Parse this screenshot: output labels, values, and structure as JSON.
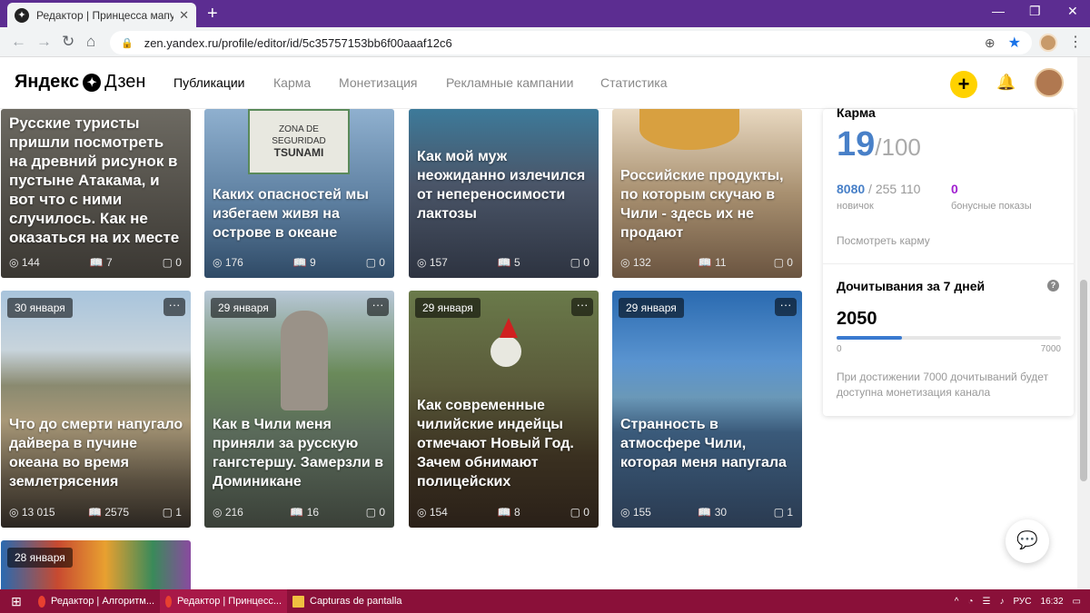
{
  "browser": {
    "tab_title": "Редактор | Принцесса мапуче |",
    "url": "zen.yandex.ru/profile/editor/id/5c35757153bb6f00aaaf12c6"
  },
  "header": {
    "logo_left": "Яндекс",
    "logo_right": "Дзен",
    "nav": [
      "Публикации",
      "Карма",
      "Монетизация",
      "Рекламные кампании",
      "Статистика"
    ]
  },
  "cards": [
    {
      "title": "Русские туристы пришли посмотреть на древний рисунок в пустыне Атакама, и вот что с ними случилось. Как не оказаться на их месте",
      "views": "144",
      "reads": "7",
      "comments": "0"
    },
    {
      "title": "Каких опасностей мы избегаем живя на острове в океане",
      "views": "176",
      "reads": "9",
      "comments": "0"
    },
    {
      "title": "Как мой муж неожиданно излечился от непереносимости лактозы",
      "views": "157",
      "reads": "5",
      "comments": "0"
    },
    {
      "title": "Российские продукты, по которым скучаю в Чили - здесь их не продают",
      "views": "132",
      "reads": "11",
      "comments": "0"
    },
    {
      "date": "30 января",
      "title": "Что до смерти напугало дайвера в пучине океана во время землетрясения",
      "views": "13 015",
      "reads": "2575",
      "comments": "1"
    },
    {
      "date": "29 января",
      "title": "Как в Чили меня приняли за русскую гангстершу. Замерзли в Доминикане",
      "views": "216",
      "reads": "16",
      "comments": "0"
    },
    {
      "date": "29 января",
      "title": "Как современные чилийские индейцы отмечают Новый Год. Зачем обнимают полицейских",
      "views": "154",
      "reads": "8",
      "comments": "0"
    },
    {
      "date": "29 января",
      "title": "Странность в атмосфере Чили, которая меня напугала",
      "views": "155",
      "reads": "30",
      "comments": "1"
    },
    {
      "date": "28 января"
    }
  ],
  "sidebar": {
    "karma_heading": "Карма",
    "karma_value": "19",
    "karma_max": "/100",
    "new_count": "8080",
    "new_total": "/ 255 110",
    "new_label": "новичок",
    "bonus_count": "0",
    "bonus_label": "бонусные показы",
    "karma_link": "Посмотреть карму",
    "reads_heading": "Дочитывания за 7 дней",
    "reads_value": "2050",
    "reads_progress": 0.293,
    "scale_min": "0",
    "scale_max": "7000",
    "note": "При достижении 7000 дочитываний будет доступна монетизация канала"
  },
  "taskbar": {
    "items": [
      "Редактор | Алгоритм...",
      "Редактор | Принцесс...",
      "Capturas de pantalla"
    ],
    "lang": "РУС",
    "time": "16:32"
  }
}
